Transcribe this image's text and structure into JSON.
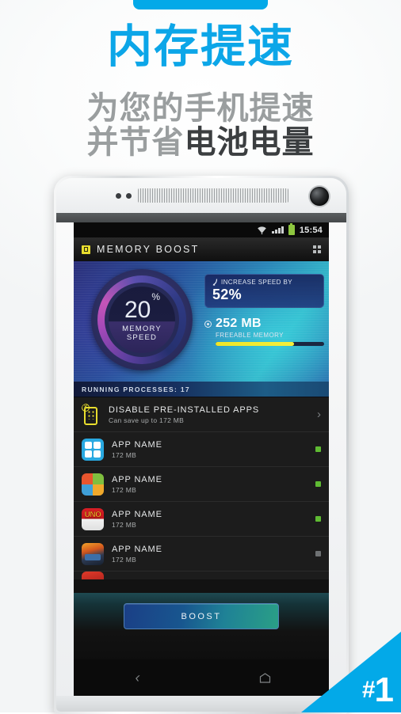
{
  "promo": {
    "headline": "内存提速",
    "subtitle_line1": "为您的手机提速",
    "subtitle_line2_light": "并节省",
    "subtitle_line2_dark": "电池电量",
    "accent_color": "#03A9E8",
    "subtitle_color": "#9A9E9F",
    "subtitle_dark_color": "#3B3E40",
    "badge_hash": "#",
    "badge_number": "1"
  },
  "status_bar": {
    "wifi_icon": "wifi-icon",
    "signal_icon": "signal-bars-icon",
    "battery_icon": "battery-icon",
    "battery_color": "#8dc63f",
    "clock": "15:54"
  },
  "app_header": {
    "logo_icon": "memory-boost-logo-icon",
    "logo_color": "#E8DD2E",
    "title": "MEMORY BOOST",
    "grid_icon": "grid-menu-icon"
  },
  "hero": {
    "gauge": {
      "value": "20",
      "unit": "%",
      "label_line1": "MEMORY",
      "label_line2": "SPEED"
    },
    "speed_panel": {
      "icon": "speed-arrow-icon",
      "label": "INCREASE SPEED BY",
      "value": "52%"
    },
    "memory": {
      "dot_icon": "radio-dot-icon",
      "value": "252 MB",
      "label": "FREEABLE MEMORY",
      "bar_percent": 72,
      "bar_color": "#efe528"
    }
  },
  "processes_strip": {
    "label": "RUNNING PROCESSES: 17"
  },
  "disable_row": {
    "icon": "disable-preinstalled-apps-icon",
    "title": "DISABLE PRE-INSTALLED APPS",
    "subtitle": "Can save up to 172 MB",
    "chevron_icon": "chevron-right-icon"
  },
  "app_rows": [
    {
      "icon": "app-icon-blue-grid",
      "title": "APP NAME",
      "size": "172 MB",
      "led": "on"
    },
    {
      "icon": "app-icon-quad-color",
      "title": "APP NAME",
      "size": "172 MB",
      "led": "on"
    },
    {
      "icon": "app-icon-uno-game",
      "title": "APP NAME",
      "size": "172 MB",
      "led": "on"
    },
    {
      "icon": "app-icon-car-game",
      "title": "APP NAME",
      "size": "172 MB",
      "led": "off"
    }
  ],
  "boost": {
    "label": "BOOST"
  },
  "nav_bar": {
    "back_icon": "back-arrow-icon",
    "home_icon": "home-icon"
  }
}
